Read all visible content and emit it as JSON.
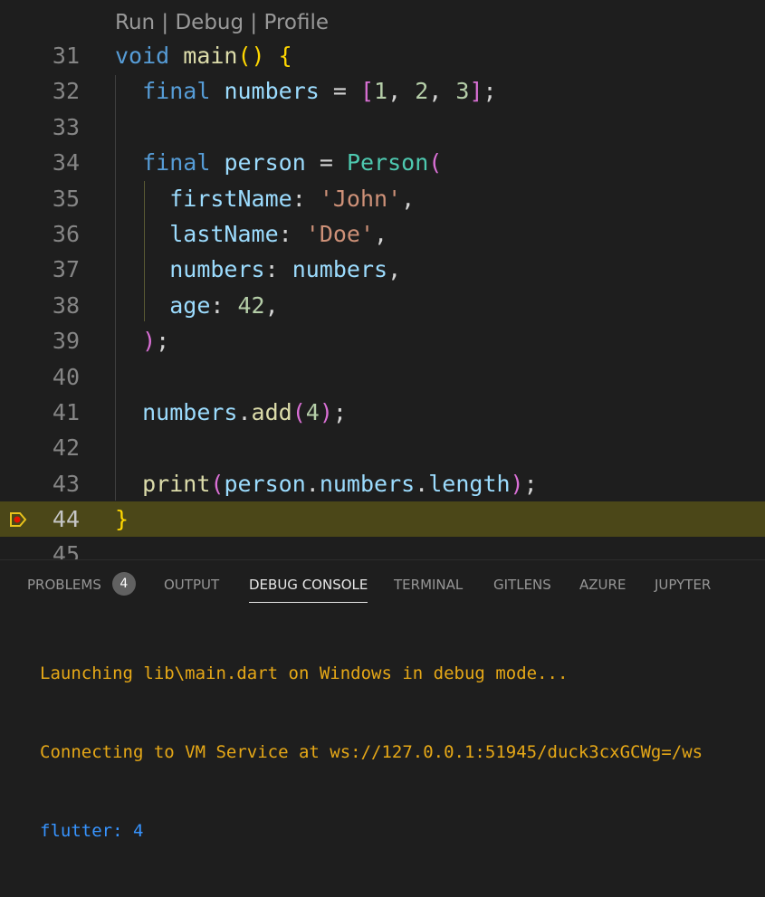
{
  "codelens": "Run | Debug | Profile",
  "line_numbers": [
    "31",
    "32",
    "33",
    "34",
    "35",
    "36",
    "37",
    "38",
    "39",
    "40",
    "41",
    "42",
    "43",
    "44",
    "45"
  ],
  "code": {
    "l31": {
      "kw": "void",
      "fn": "main",
      "p": "()",
      "brace": "{"
    },
    "l32": {
      "kw": "final",
      "var": "numbers",
      "eq": "=",
      "open": "[",
      "n1": "1",
      "n2": "2",
      "n3": "3",
      "close": "]",
      "semi": ";"
    },
    "l34": {
      "kw": "final",
      "var": "person",
      "eq": "=",
      "cls": "Person",
      "open": "("
    },
    "l35": {
      "name": "firstName",
      "colon": ":",
      "str": "'John'",
      "comma": ","
    },
    "l36": {
      "name": "lastName",
      "colon": ":",
      "str": "'Doe'",
      "comma": ","
    },
    "l37": {
      "name": "numbers",
      "colon": ":",
      "val": "numbers",
      "comma": ","
    },
    "l38": {
      "name": "age",
      "colon": ":",
      "num": "42",
      "comma": ","
    },
    "l39": {
      "close": ")",
      "semi": ";"
    },
    "l41": {
      "var": "numbers",
      "dot": ".",
      "fn": "add",
      "open": "(",
      "num": "4",
      "close": ")",
      "semi": ";"
    },
    "l43": {
      "fn": "print",
      "open": "(",
      "v1": "person",
      "d1": ".",
      "v2": "numbers",
      "d2": ".",
      "v3": "length",
      "close": ")",
      "semi": ";"
    },
    "l44": {
      "brace": "}"
    }
  },
  "colors": {
    "current_line": "#4b4718",
    "breakpoint": "#e8c21b"
  },
  "panel": {
    "tabs": [
      "PROBLEMS",
      "OUTPUT",
      "DEBUG CONSOLE",
      "TERMINAL",
      "GITLENS",
      "AZURE",
      "JUPYTER"
    ],
    "active_tab": "DEBUG CONSOLE",
    "problems_count": "4"
  },
  "console": [
    "Launching lib\\main.dart on Windows in debug mode...",
    "Connecting to VM Service at ws://127.0.0.1:51945/duck3cxGCWg=/ws",
    "flutter: 4"
  ]
}
